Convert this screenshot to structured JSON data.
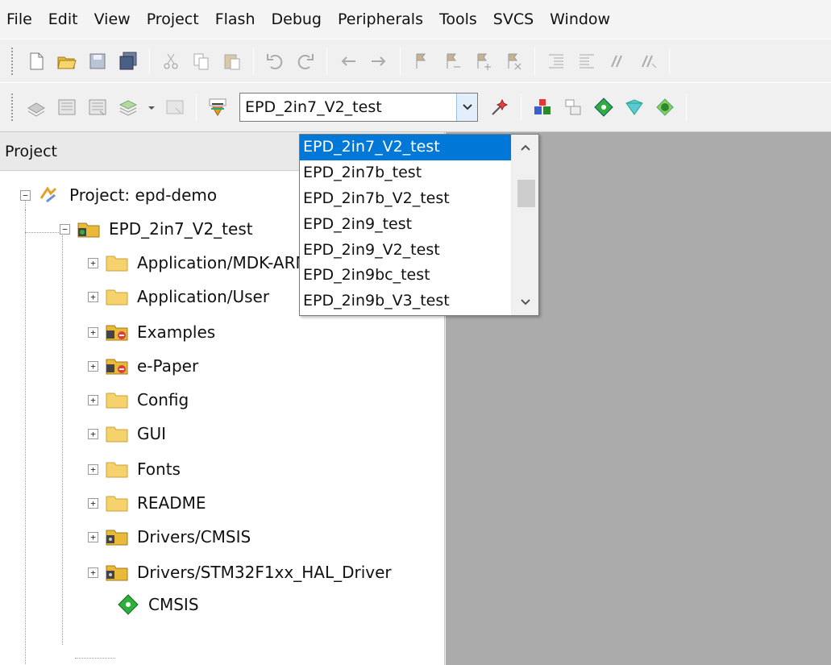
{
  "menu": [
    "File",
    "Edit",
    "View",
    "Project",
    "Flash",
    "Debug",
    "Peripherals",
    "Tools",
    "SVCS",
    "Window"
  ],
  "target": {
    "selected": "EPD_2in7_V2_test",
    "options": [
      "EPD_2in7_V2_test",
      "EPD_2in7b_test",
      "EPD_2in7b_V2_test",
      "EPD_2in9_test",
      "EPD_2in9_V2_test",
      "EPD_2in9bc_test",
      "EPD_2in9b_V3_test"
    ]
  },
  "project_pane": {
    "title": "Project",
    "root": "Project: epd-demo",
    "target_node": "EPD_2in7_V2_test",
    "groups": [
      "Application/MDK-ARM",
      "Application/User",
      "Examples",
      "e-Paper",
      "Config",
      "GUI",
      "Fonts",
      "README",
      "Drivers/CMSIS",
      "Drivers/STM32F1xx_HAL_Driver"
    ],
    "component": "CMSIS"
  },
  "colors": {
    "selection": "#0078d7",
    "editor_bg": "#ababab",
    "folder": "#f5d26b"
  }
}
